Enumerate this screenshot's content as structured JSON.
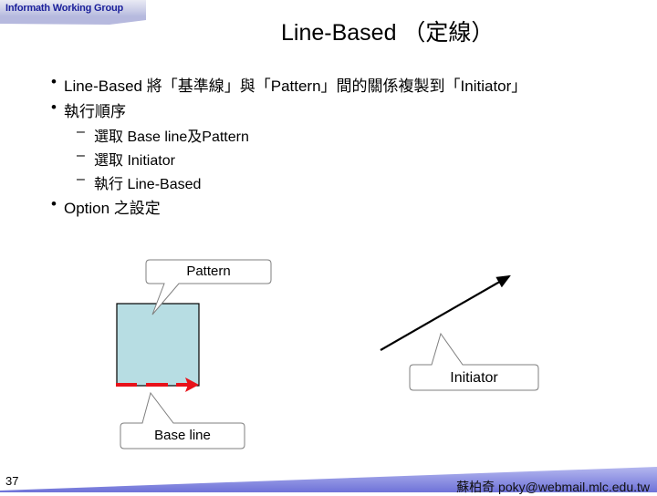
{
  "header": {
    "group_name": "Informath Working Group"
  },
  "slide": {
    "title": "Line-Based （定線）",
    "bullets": [
      {
        "symbol": "•",
        "text": "Line-Based 將「基準線」與「Pattern」間的關係複製到「Initiator」"
      },
      {
        "symbol": "•",
        "text": "執行順序"
      },
      {
        "symbol": "•",
        "text": "Option 之設定"
      }
    ],
    "sub_bullets": [
      {
        "symbol": "–",
        "text": "選取 Base line及Pattern"
      },
      {
        "symbol": "–",
        "text": "選取 Initiator"
      },
      {
        "symbol": "–",
        "text": "執行 Line-Based"
      }
    ]
  },
  "diagram": {
    "callouts": {
      "pattern": "Pattern",
      "initiator": "Initiator",
      "base_line": "Base line"
    },
    "colors": {
      "pattern_fill": "#b7dde3",
      "base_line": "#e8121a",
      "initiator_line": "#000000",
      "callout_border": "#7f7f7f"
    }
  },
  "footer": {
    "page_number": "37",
    "author": "蘇柏奇 poky@webmail.mlc.edu.tw",
    "band_color": "#7b7fdc"
  }
}
